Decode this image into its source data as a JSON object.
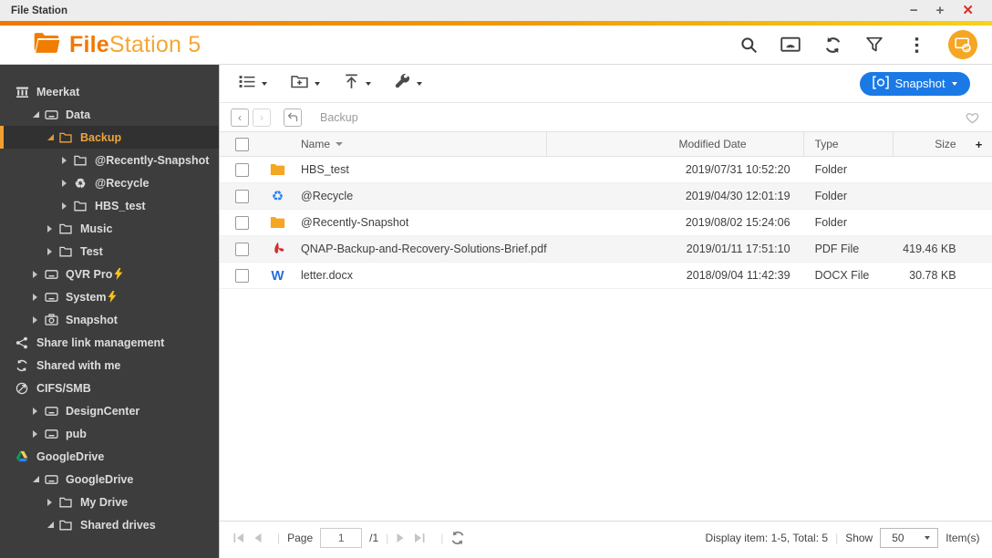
{
  "window": {
    "title": "File Station",
    "controls": {
      "minimize": "−",
      "maximize": "+",
      "close": "✕"
    }
  },
  "header": {
    "logo_bold": "File",
    "logo_rest": "Station 5",
    "icon_names": [
      "search-icon",
      "cast-icon",
      "refresh-icon",
      "filter-icon",
      "more-icon",
      "background-task-icon"
    ]
  },
  "toolbar": {
    "snapshot_label": "Snapshot",
    "button_icons": [
      "list-view-icon",
      "create-folder-icon",
      "upload-icon",
      "tools-icon"
    ]
  },
  "breadcrumb": {
    "path": "Backup"
  },
  "sidebar": {
    "items": [
      {
        "label": "Meerkat",
        "level": 0,
        "icon": "nas",
        "expand": "none"
      },
      {
        "label": "Data",
        "level": 1,
        "icon": "drive",
        "expand": "expanded"
      },
      {
        "label": "Backup",
        "level": 2,
        "icon": "folder",
        "expand": "expanded",
        "selected": true
      },
      {
        "label": "@Recently-Snapshot",
        "level": 3,
        "icon": "folder",
        "expand": "collapsed"
      },
      {
        "label": "@Recycle",
        "level": 3,
        "icon": "recycle",
        "expand": "collapsed"
      },
      {
        "label": "HBS_test",
        "level": 3,
        "icon": "folder",
        "expand": "collapsed"
      },
      {
        "label": "Music",
        "level": 2,
        "icon": "folder",
        "expand": "collapsed"
      },
      {
        "label": "Test",
        "level": 2,
        "icon": "folder",
        "expand": "collapsed"
      },
      {
        "label": "QVR Pro",
        "level": 1,
        "icon": "drive",
        "expand": "collapsed",
        "bolt": true
      },
      {
        "label": "System",
        "level": 1,
        "icon": "drive",
        "expand": "collapsed",
        "bolt": true
      },
      {
        "label": "Snapshot",
        "level": 1,
        "icon": "camera",
        "expand": "collapsed"
      },
      {
        "label": "Share link management",
        "level": 0,
        "icon": "share",
        "expand": "none"
      },
      {
        "label": "Shared with me",
        "level": 0,
        "icon": "sync",
        "expand": "none"
      },
      {
        "label": "CIFS/SMB",
        "level": 0,
        "icon": "network",
        "expand": "none"
      },
      {
        "label": "DesignCenter",
        "level": 1,
        "icon": "drive",
        "expand": "collapsed"
      },
      {
        "label": "pub",
        "level": 1,
        "icon": "drive",
        "expand": "collapsed"
      },
      {
        "label": "GoogleDrive",
        "level": 0,
        "icon": "gdrive",
        "expand": "none"
      },
      {
        "label": "GoogleDrive",
        "level": 1,
        "icon": "drive",
        "expand": "expanded"
      },
      {
        "label": "My Drive",
        "level": 2,
        "icon": "folder",
        "expand": "collapsed"
      },
      {
        "label": "Shared drives",
        "level": 2,
        "icon": "folder",
        "expand": "expanded"
      }
    ]
  },
  "table": {
    "columns": {
      "name": "Name",
      "modified": "Modified Date",
      "type": "Type",
      "size": "Size",
      "add_column": "+"
    },
    "rows": [
      {
        "icon": "folder",
        "name": "HBS_test",
        "modified": "2019/07/31 10:52:20",
        "type": "Folder",
        "size": ""
      },
      {
        "icon": "recycle",
        "name": "@Recycle",
        "modified": "2019/04/30 12:01:19",
        "type": "Folder",
        "size": ""
      },
      {
        "icon": "folder",
        "name": "@Recently-Snapshot",
        "modified": "2019/08/02 15:24:06",
        "type": "Folder",
        "size": ""
      },
      {
        "icon": "pdf",
        "name": "QNAP-Backup-and-Recovery-Solutions-Brief.pdf",
        "modified": "2019/01/11 17:51:10",
        "type": "PDF File",
        "size": "419.46 KB"
      },
      {
        "icon": "word",
        "name": "letter.docx",
        "modified": "2018/09/04 11:42:39",
        "type": "DOCX File",
        "size": "30.78 KB"
      }
    ]
  },
  "footer": {
    "page_label": "Page",
    "page_value": "1",
    "page_total": "/1",
    "display_info": "Display item: 1-5, Total: 5",
    "show_label": "Show",
    "show_value": "50",
    "items_label": "Item(s)"
  },
  "colors": {
    "accent_orange": "#f07800",
    "accent_yellow": "#f7d21e",
    "snapshot_blue": "#1b79e6",
    "selected_orange": "#f0a43c",
    "sidebar_bg": "#3d3d3d",
    "folder_icon": "#f5a623",
    "pdf_red": "#d0312d",
    "word_blue": "#2a6fdb",
    "recycle_blue": "#2d7ff0"
  }
}
